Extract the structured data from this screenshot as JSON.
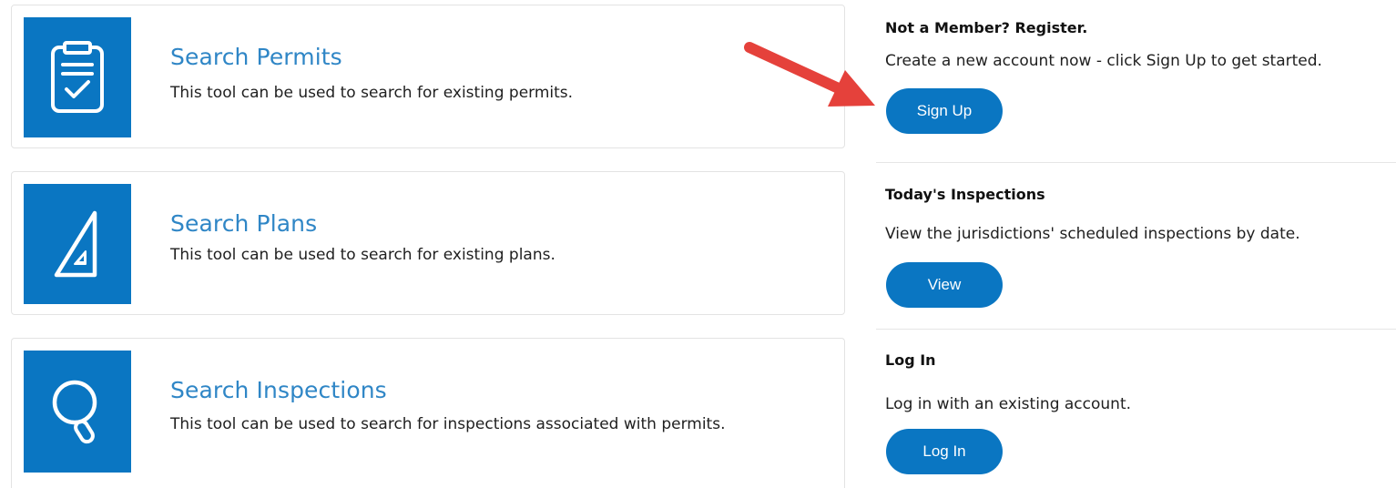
{
  "tools": [
    {
      "title": "Search Permits",
      "description": "This tool can be used to search for existing permits.",
      "icon": "clipboard-check-icon"
    },
    {
      "title": "Search Plans",
      "description": "This tool can be used to search for existing plans.",
      "icon": "set-square-icon"
    },
    {
      "title": "Search Inspections",
      "description": "This tool can be used to search for inspections associated with permits.",
      "icon": "magnifier-icon"
    }
  ],
  "sidebar": {
    "register": {
      "heading": "Not a Member? Register.",
      "text": "Create a new account now - click Sign Up to get started.",
      "button": "Sign Up"
    },
    "inspections": {
      "heading": "Today's Inspections",
      "text": "View the jurisdictions' scheduled inspections by date.",
      "button": "View"
    },
    "login": {
      "heading": "Log In",
      "text": "Log in with an existing account.",
      "button": "Log In"
    }
  },
  "colors": {
    "brand_blue": "#0a76c2",
    "link_blue": "#2f86c6",
    "arrow_red": "#e5413b"
  }
}
